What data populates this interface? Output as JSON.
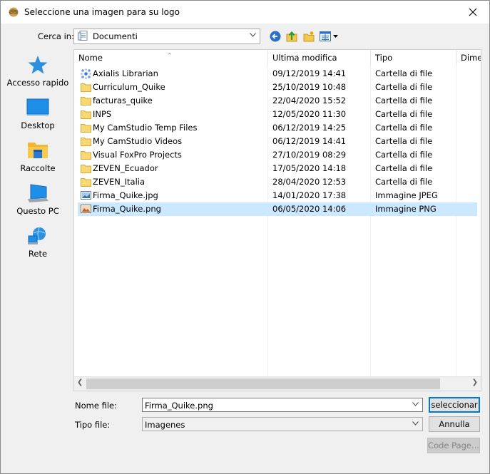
{
  "window": {
    "title": "Seleccione una imagen para su logo"
  },
  "toolbar": {
    "lookin_label": "Cerca in:",
    "lookin_value": "Documenti",
    "icons": [
      "back-icon",
      "up-folder-icon",
      "new-folder-icon",
      "view-menu-icon"
    ]
  },
  "places": [
    {
      "label": "Accesso rapido",
      "icon": "quick-access-star-icon"
    },
    {
      "label": "Desktop",
      "icon": "desktop-icon"
    },
    {
      "label": "Raccolte",
      "icon": "libraries-icon"
    },
    {
      "label": "Questo PC",
      "icon": "computer-icon"
    },
    {
      "label": "Rete",
      "icon": "network-icon"
    }
  ],
  "columns": [
    "Nome",
    "Ultima modifica",
    "Tipo",
    "Dime"
  ],
  "files": [
    {
      "name": "Axialis Librarian",
      "modified": "09/12/2019 14:41",
      "type": "Cartella di file",
      "icon": "axialis-folder-icon"
    },
    {
      "name": "Curriculum_Quike",
      "modified": "25/10/2019 10:48",
      "type": "Cartella di file",
      "icon": "folder-icon"
    },
    {
      "name": "facturas_quike",
      "modified": "22/04/2020 15:52",
      "type": "Cartella di file",
      "icon": "folder-icon"
    },
    {
      "name": "INPS",
      "modified": "12/05/2020 11:30",
      "type": "Cartella di file",
      "icon": "folder-icon"
    },
    {
      "name": "My CamStudio Temp Files",
      "modified": "06/12/2019 14:25",
      "type": "Cartella di file",
      "icon": "folder-icon"
    },
    {
      "name": "My CamStudio Videos",
      "modified": "06/12/2019 14:41",
      "type": "Cartella di file",
      "icon": "folder-icon"
    },
    {
      "name": "Visual FoxPro Projects",
      "modified": "27/10/2019 08:29",
      "type": "Cartella di file",
      "icon": "folder-icon"
    },
    {
      "name": "ZEVEN_Ecuador",
      "modified": "17/05/2020 14:18",
      "type": "Cartella di file",
      "icon": "folder-icon"
    },
    {
      "name": "ZEVEN_Italia",
      "modified": "28/04/2020 12:53",
      "type": "Cartella di file",
      "icon": "folder-icon"
    },
    {
      "name": "Firma_Quike.jpg",
      "modified": "14/01/2020 17:38",
      "type": "Immagine JPEG",
      "icon": "jpeg-file-icon"
    },
    {
      "name": "Firma_Quike.png",
      "modified": "06/05/2020 14:06",
      "type": "Immagine PNG",
      "icon": "png-file-icon",
      "selected": true
    }
  ],
  "bottom": {
    "filename_label": "Nome file:",
    "filename_value": "Firma_Quike.png",
    "filetype_label": "Tipo file:",
    "filetype_value": "Imagenes",
    "select_button": "seleccionar",
    "cancel_button": "Annulla",
    "codepage_button": "Code Page..."
  },
  "colors": {
    "selection": "#cce8ff",
    "accent": "#0078d7",
    "folder": "#f5c84c"
  }
}
